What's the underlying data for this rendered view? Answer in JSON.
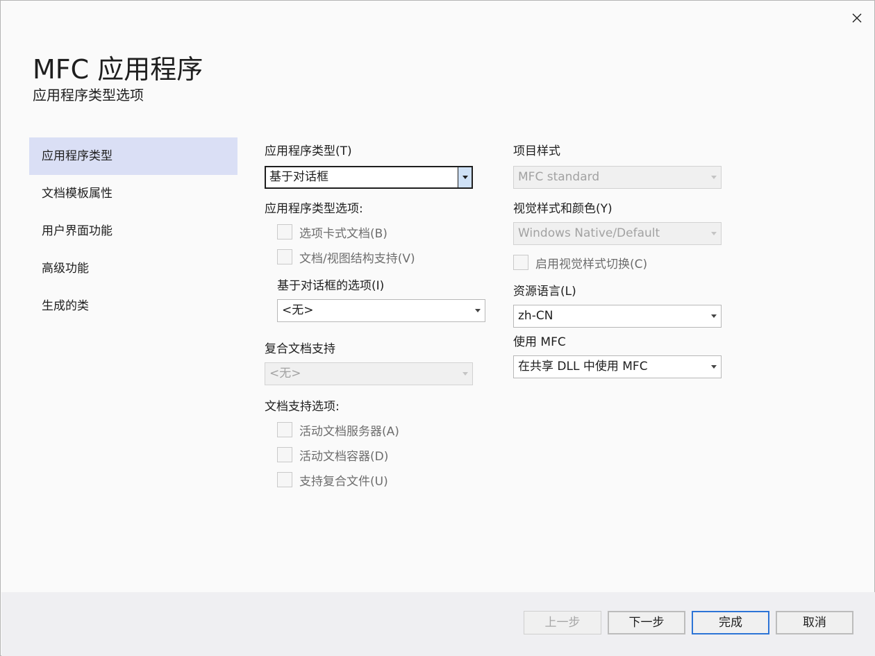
{
  "window": {
    "title": "MFC 应用程序",
    "subtitle": "应用程序类型选项"
  },
  "sidebar": {
    "items": [
      {
        "label": "应用程序类型",
        "selected": true
      },
      {
        "label": "文档模板属性",
        "selected": false
      },
      {
        "label": "用户界面功能",
        "selected": false
      },
      {
        "label": "高级功能",
        "selected": false
      },
      {
        "label": "生成的类",
        "selected": false
      }
    ]
  },
  "left": {
    "app_type_label": "应用程序类型(T)",
    "app_type_value": "基于对话框",
    "app_type_options_label": "应用程序类型选项:",
    "tabbed_docs_label": "选项卡式文档(B)",
    "doc_view_label": "文档/视图结构支持(V)",
    "dialog_options_label": "基于对话框的选项(I)",
    "dialog_options_value": "<无>",
    "compound_doc_label": "复合文档支持",
    "compound_doc_value": "<无>",
    "doc_support_label": "文档支持选项:",
    "active_server_label": "活动文档服务器(A)",
    "active_container_label": "活动文档容器(D)",
    "compound_files_label": "支持复合文件(U)"
  },
  "right": {
    "project_style_label": "项目样式",
    "project_style_value": "MFC standard",
    "visual_style_label": "视觉样式和颜色(Y)",
    "visual_style_value": "Windows Native/Default",
    "style_switch_label": "启用视觉样式切换(C)",
    "resource_lang_label": "资源语言(L)",
    "resource_lang_value": "zh-CN",
    "use_mfc_label": "使用 MFC",
    "use_mfc_value": "在共享 DLL 中使用 MFC"
  },
  "footer": {
    "back": "上一步",
    "next": "下一步",
    "finish": "完成",
    "cancel": "取消"
  },
  "colors": {
    "selected_nav": "#dadff5",
    "primary_border": "#2c74d6",
    "footer_bg": "#efeff2"
  }
}
